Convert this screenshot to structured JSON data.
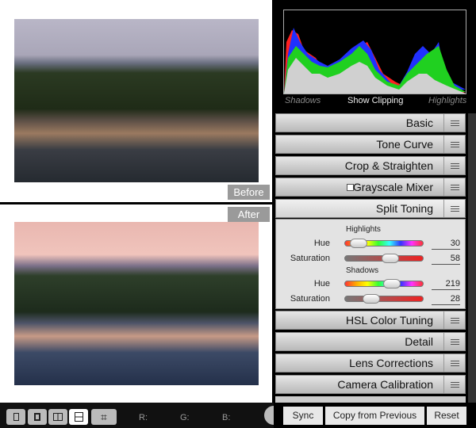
{
  "preview": {
    "before_label": "Before",
    "after_label": "After"
  },
  "toolbar": {
    "views": [
      "loupe-view",
      "reference-view",
      "before-after-left-right",
      "before-after-top-bottom",
      "crop-tool"
    ],
    "active_view": "before-after-top-bottom",
    "r_label": "R:",
    "g_label": "G:",
    "b_label": "B:"
  },
  "histogram": {
    "shadows_label": "Shadows",
    "clipping_label": "Show Clipping",
    "highlights_label": "Highlights"
  },
  "panels": {
    "basic": "Basic",
    "tone_curve": "Tone Curve",
    "crop": "Crop & Straighten",
    "grayscale": "Grayscale Mixer",
    "split_toning": "Split Toning",
    "hsl": "HSL Color Tuning",
    "detail": "Detail",
    "lens": "Lens Corrections",
    "camera": "Camera Calibration"
  },
  "split_toning": {
    "highlights_label": "Highlights",
    "shadows_label": "Shadows",
    "highlights": {
      "hue_label": "Hue",
      "hue": "30",
      "sat_label": "Saturation",
      "sat": "58"
    },
    "shadows": {
      "hue_label": "Hue",
      "hue": "219",
      "sat_label": "Saturation",
      "sat": "28"
    }
  },
  "buttons": {
    "sync": "Sync",
    "copy": "Copy from Previous",
    "reset": "Reset"
  }
}
